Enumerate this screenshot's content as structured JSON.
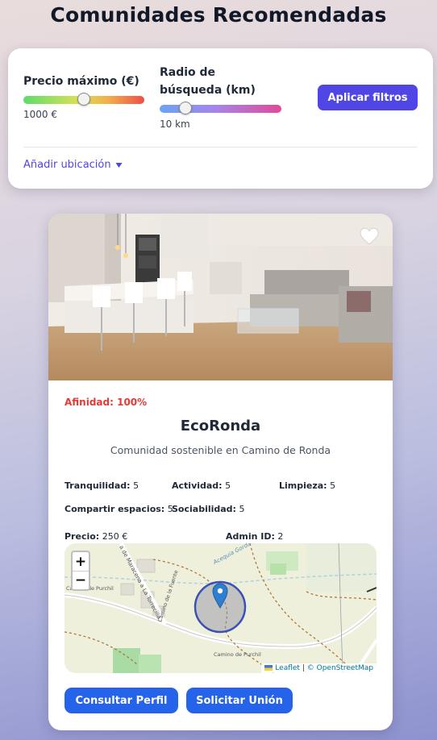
{
  "page_title": "Comunidades Recomendadas",
  "filters": {
    "price": {
      "label": "Precio máximo (€)",
      "value_text": "1000 €",
      "level": 0.5
    },
    "radius": {
      "label": "Radio de búsqueda (km)",
      "value_text": "10 km",
      "level": 0.2
    },
    "apply_label": "Aplicar filtros",
    "add_location_label": "Añadir ubicación",
    "add_location_icon": "caret-down-icon"
  },
  "community": {
    "affinity": "Afinidad: 100%",
    "name": "EcoRonda",
    "description": "Comunidad sostenible en Camino de Ronda",
    "stats": {
      "tranquilidad": {
        "label": "Tranquilidad:",
        "value": "5"
      },
      "actividad": {
        "label": "Actividad:",
        "value": "5"
      },
      "limpieza": {
        "label": "Limpieza:",
        "value": "5"
      },
      "compartir": {
        "label": "Compartir espacios:",
        "value": "5"
      },
      "sociabilidad": {
        "label": "Sociabilidad:",
        "value": "5"
      }
    },
    "price": {
      "label": "Precio:",
      "value": "250 €"
    },
    "admin": {
      "label": "Admin ID:",
      "value": "2"
    },
    "favorite_icon": "heart-outline-icon",
    "map": {
      "zoom_in": "+",
      "zoom_out": "−",
      "road_1": "Camino de Purchil",
      "road_2": "Camino de Purchil",
      "road_3": "Acequia Gorda del Genil",
      "road_4": "Camino de la Fuente",
      "road_5": "a de Maracena a La Torrecilla",
      "attribution_link": "Leaflet",
      "attribution_sep": "|",
      "attribution_text": "© OpenStreetMap",
      "marker_icon": "location-pin-icon"
    },
    "actions": {
      "profile_label": "Consultar Perfil",
      "join_label": "Solicitar Unión"
    }
  },
  "colors": {
    "accent": "#4f46e5",
    "button_blue": "#2563eb",
    "affinity_red": "#e53935"
  }
}
